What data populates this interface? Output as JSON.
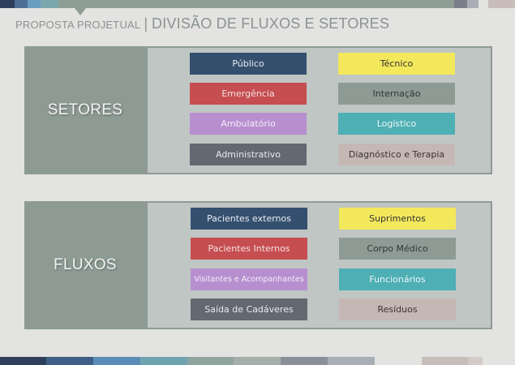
{
  "header": {
    "subtitle": "PROPOSTA PROJETUAL",
    "separator": "|",
    "title": "DIVISÃO DE FLUXOS E SETORES"
  },
  "colors": {
    "navy": "#35506f",
    "red": "#c64d50",
    "lavender": "#b78fcf",
    "slate": "#646872",
    "yellow": "#f3e85c",
    "sage": "#8e9b95",
    "teal": "#4eafb4",
    "taupe": "#c5b7b4"
  },
  "sections": {
    "setores": {
      "label": "SETORES",
      "items": [
        {
          "text": "Público",
          "color": "#35506f",
          "text_color": "#e8ecf2"
        },
        {
          "text": "Técnico",
          "color": "#f3e85c",
          "text_color": "#333333"
        },
        {
          "text": "Emergência",
          "color": "#c64d50",
          "text_color": "#f4e2e2"
        },
        {
          "text": "Internação",
          "color": "#8e9b95",
          "text_color": "#2f3533"
        },
        {
          "text": "Ambulatório",
          "color": "#b78fcf",
          "text_color": "#f4eef8"
        },
        {
          "text": "Logístico",
          "color": "#4eafb4",
          "text_color": "#eef7f8"
        },
        {
          "text": "Administrativo",
          "color": "#646872",
          "text_color": "#e8e9ec"
        },
        {
          "text": "Diagnóstico e Terapia",
          "color": "#c5b7b4",
          "text_color": "#3a3433"
        }
      ]
    },
    "fluxos": {
      "label": "FLUXOS",
      "items": [
        {
          "text": "Pacientes externos",
          "color": "#35506f",
          "text_color": "#e8ecf2"
        },
        {
          "text": "Suprimentos",
          "color": "#f3e85c",
          "text_color": "#333333"
        },
        {
          "text": "Pacientes Internos",
          "color": "#c64d50",
          "text_color": "#f4e2e2"
        },
        {
          "text": "Corpo Médico",
          "color": "#8e9b95",
          "text_color": "#2f3533"
        },
        {
          "text": "Visitantes e Acompanhantes",
          "color": "#b78fcf",
          "text_color": "#f4eef8"
        },
        {
          "text": "Funcionários",
          "color": "#4eafb4",
          "text_color": "#eef7f8"
        },
        {
          "text": "Saída de Cadáveres",
          "color": "#646872",
          "text_color": "#e8e9ec"
        },
        {
          "text": "Resíduos",
          "color": "#c5b7b4",
          "text_color": "#3a3433"
        }
      ]
    }
  }
}
